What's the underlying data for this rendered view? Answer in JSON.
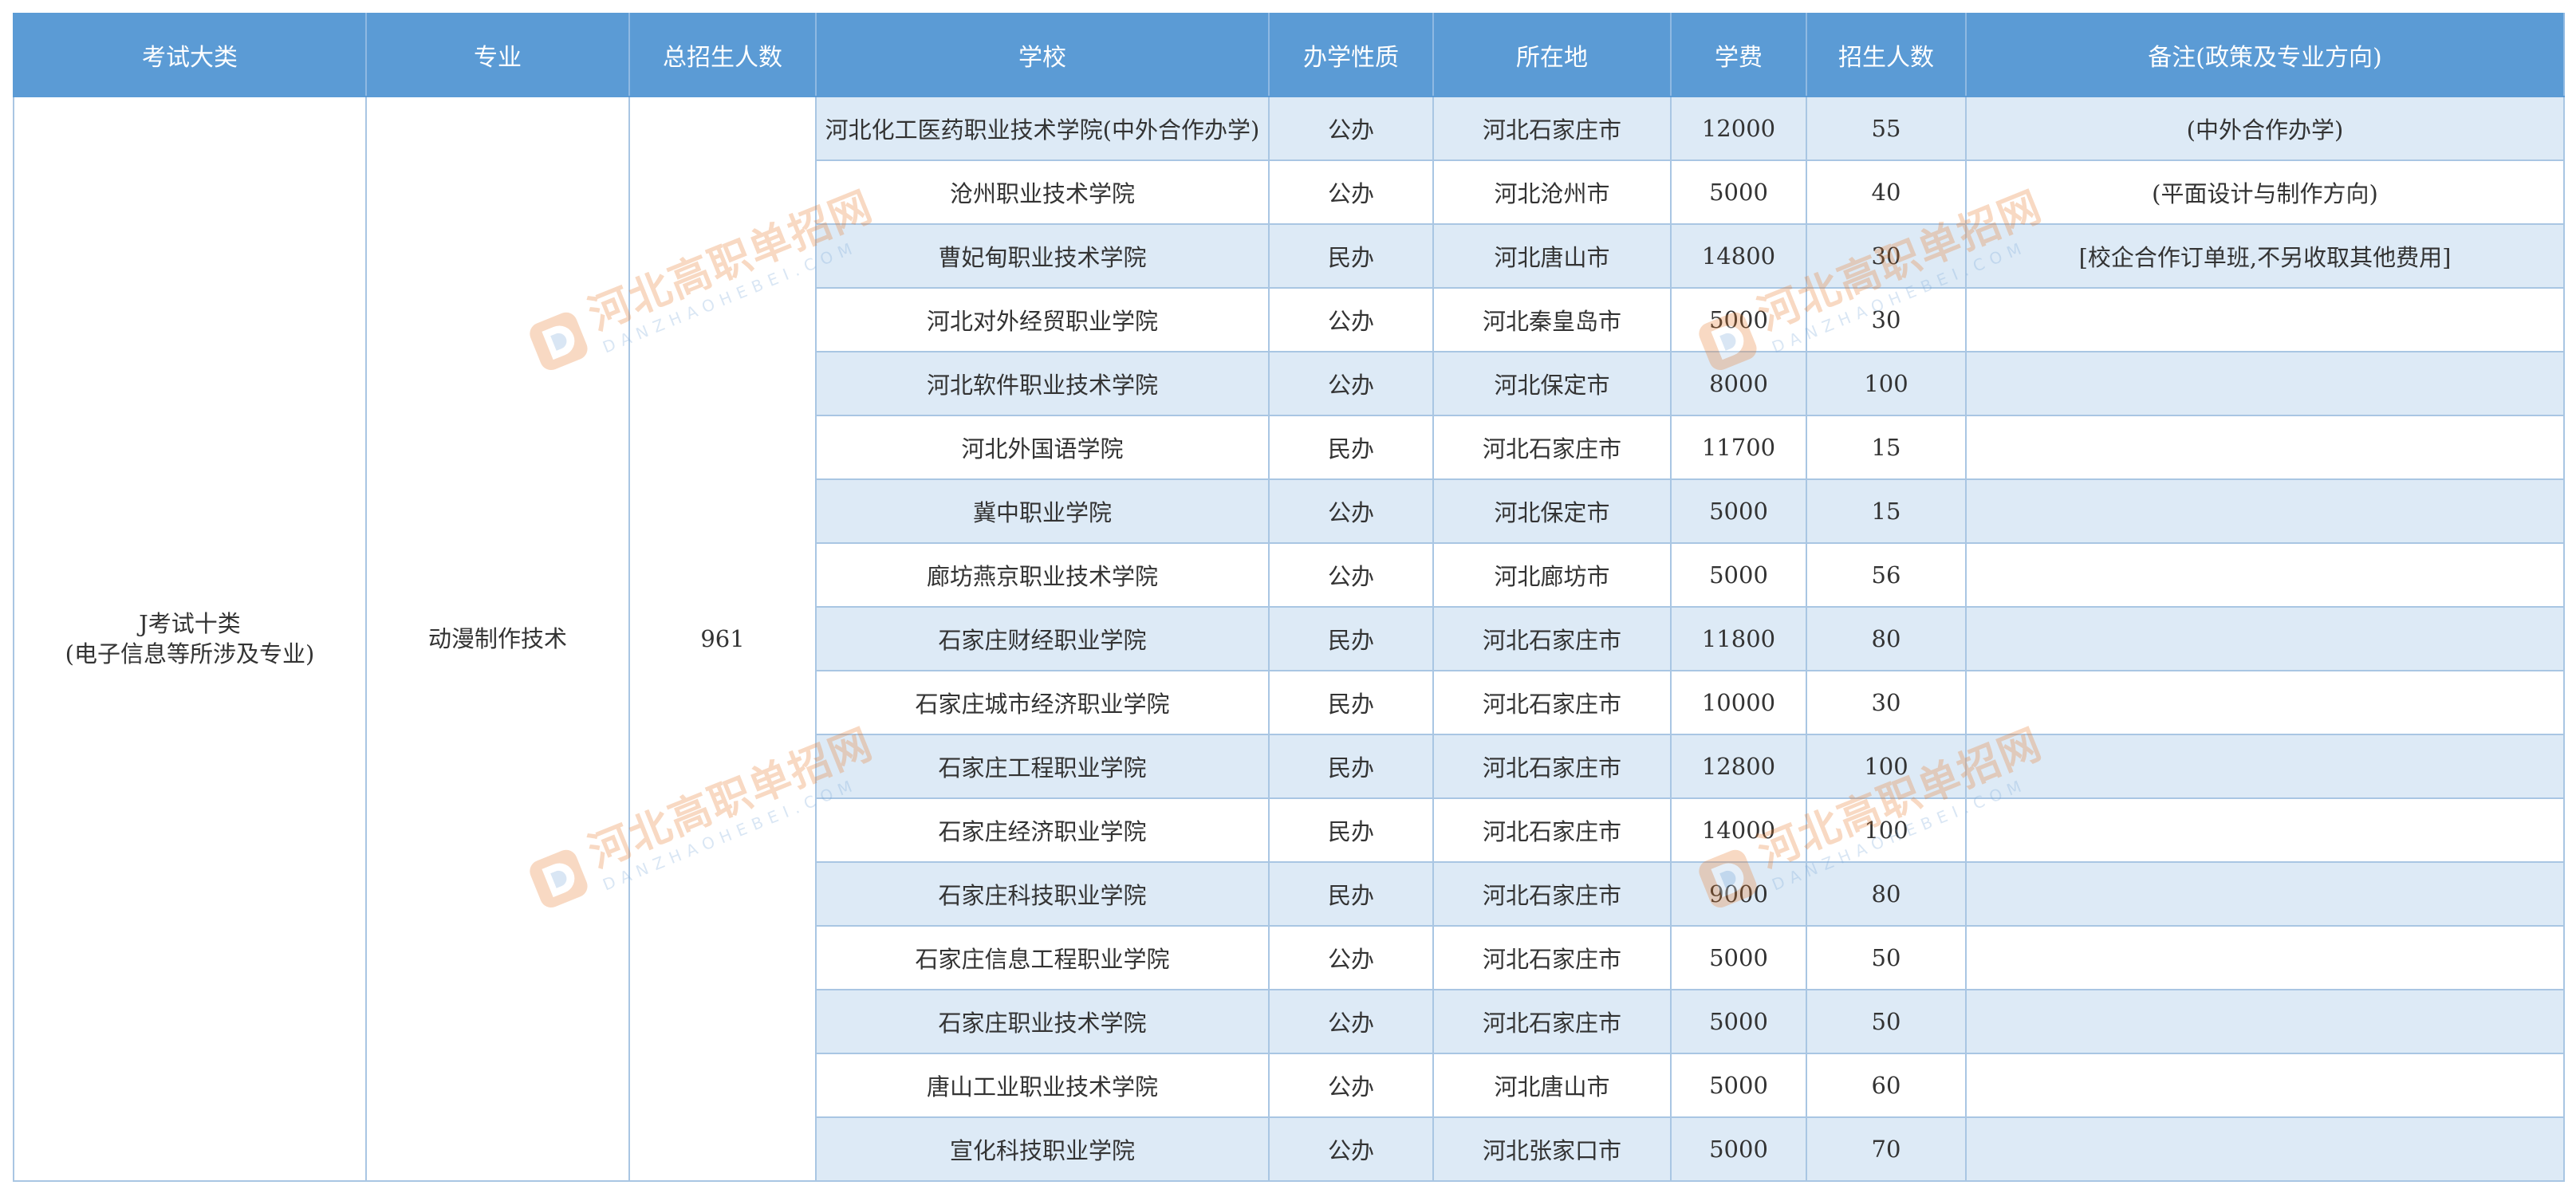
{
  "headers": [
    "考试大类",
    "专业",
    "总招生人数",
    "学校",
    "办学性质",
    "所在地",
    "学费",
    "招生人数",
    "备注(政策及专业方向)"
  ],
  "group": {
    "category_line1": "J考试十类",
    "category_line2": "(电子信息等所涉及专业)",
    "major": "动漫制作技术",
    "total": "961"
  },
  "rows": [
    {
      "school": "河北化工医药职业技术学院(中外合作办学)",
      "nature": "公办",
      "location": "河北石家庄市",
      "tuition": "12000",
      "enroll": "55",
      "note": "(中外合作办学)"
    },
    {
      "school": "沧州职业技术学院",
      "nature": "公办",
      "location": "河北沧州市",
      "tuition": "5000",
      "enroll": "40",
      "note": "(平面设计与制作方向)"
    },
    {
      "school": "曹妃甸职业技术学院",
      "nature": "民办",
      "location": "河北唐山市",
      "tuition": "14800",
      "enroll": "30",
      "note": "[校企合作订单班,不另收取其他费用]"
    },
    {
      "school": "河北对外经贸职业学院",
      "nature": "公办",
      "location": "河北秦皇岛市",
      "tuition": "5000",
      "enroll": "30",
      "note": ""
    },
    {
      "school": "河北软件职业技术学院",
      "nature": "公办",
      "location": "河北保定市",
      "tuition": "8000",
      "enroll": "100",
      "note": ""
    },
    {
      "school": "河北外国语学院",
      "nature": "民办",
      "location": "河北石家庄市",
      "tuition": "11700",
      "enroll": "15",
      "note": ""
    },
    {
      "school": "冀中职业学院",
      "nature": "公办",
      "location": "河北保定市",
      "tuition": "5000",
      "enroll": "15",
      "note": ""
    },
    {
      "school": "廊坊燕京职业技术学院",
      "nature": "公办",
      "location": "河北廊坊市",
      "tuition": "5000",
      "enroll": "56",
      "note": ""
    },
    {
      "school": "石家庄财经职业学院",
      "nature": "民办",
      "location": "河北石家庄市",
      "tuition": "11800",
      "enroll": "80",
      "note": ""
    },
    {
      "school": "石家庄城市经济职业学院",
      "nature": "民办",
      "location": "河北石家庄市",
      "tuition": "10000",
      "enroll": "30",
      "note": ""
    },
    {
      "school": "石家庄工程职业学院",
      "nature": "民办",
      "location": "河北石家庄市",
      "tuition": "12800",
      "enroll": "100",
      "note": ""
    },
    {
      "school": "石家庄经济职业学院",
      "nature": "民办",
      "location": "河北石家庄市",
      "tuition": "14000",
      "enroll": "100",
      "note": ""
    },
    {
      "school": "石家庄科技职业学院",
      "nature": "民办",
      "location": "河北石家庄市",
      "tuition": "9000",
      "enroll": "80",
      "note": ""
    },
    {
      "school": "石家庄信息工程职业学院",
      "nature": "公办",
      "location": "河北石家庄市",
      "tuition": "5000",
      "enroll": "50",
      "note": ""
    },
    {
      "school": "石家庄职业技术学院",
      "nature": "公办",
      "location": "河北石家庄市",
      "tuition": "5000",
      "enroll": "50",
      "note": ""
    },
    {
      "school": "唐山工业职业技术学院",
      "nature": "公办",
      "location": "河北唐山市",
      "tuition": "5000",
      "enroll": "60",
      "note": ""
    },
    {
      "school": "宣化科技职业学院",
      "nature": "公办",
      "location": "河北张家口市",
      "tuition": "5000",
      "enroll": "70",
      "note": ""
    }
  ],
  "watermark": {
    "title": "河北高职单招网",
    "subtitle": "DANZHAOHEBEI.COM",
    "icon": "danzhao-logo-icon",
    "colors": {
      "orange": "#e87b2a",
      "blue": "#7aa9d8"
    }
  },
  "colors": {
    "header_bg": "#5b9bd5",
    "header_text": "#ffffff",
    "stripe": "#ddeaf6",
    "border": "#a9c6e3"
  }
}
